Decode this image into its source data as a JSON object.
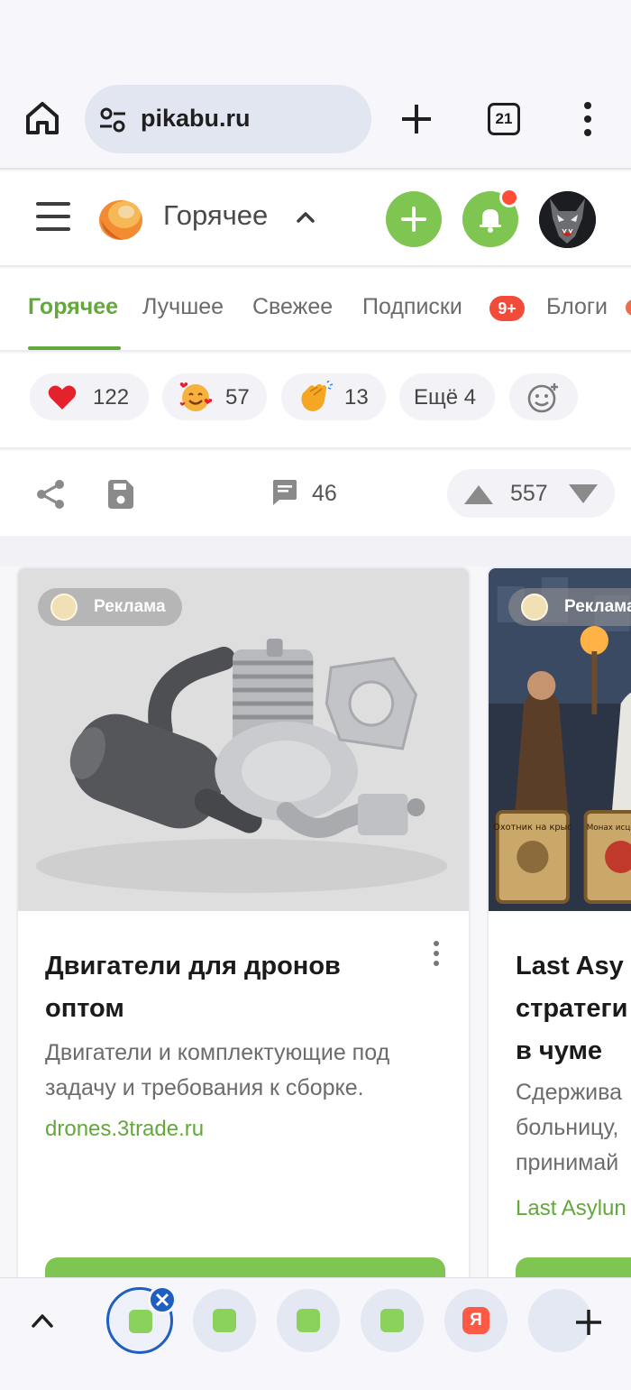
{
  "browser": {
    "url": "pikabu.ru",
    "tab_count": "21"
  },
  "header": {
    "feed_title": "Горячее",
    "icons": [
      "menu-icon",
      "logo-icon",
      "chevron-up-icon",
      "plus-icon",
      "bell-icon",
      "avatar"
    ],
    "accent": "#7ec552",
    "notification_dot_color": "#ff4d38"
  },
  "tabs": [
    {
      "label": "Горячее",
      "active": true
    },
    {
      "label": "Лучшее",
      "active": false
    },
    {
      "label": "Свежее",
      "active": false
    },
    {
      "label": "Подписки",
      "active": false,
      "badge": "9+"
    },
    {
      "label": "Блоги",
      "active": false
    }
  ],
  "reactions": [
    {
      "icon": "heart-icon",
      "count": "122"
    },
    {
      "icon": "hearts-face-icon",
      "count": "57"
    },
    {
      "icon": "clap-icon",
      "count": "13"
    },
    {
      "label": "Ещё 4"
    },
    {
      "icon": "add-reaction-icon"
    }
  ],
  "post_actions": {
    "comments": "46",
    "score": "557"
  },
  "ads": [
    {
      "label": "Реклама",
      "title": "Двигатели для дронов оптом",
      "description": "Двигатели и комплектующие под задачу и требования к сборке.",
      "domain": "drones.3trade.ru"
    },
    {
      "label": "Реклама",
      "title_lines": [
        "Last Asy",
        "стратеги",
        "в чуме"
      ],
      "description_lines": [
        "Сдержива",
        "больницу,",
        "принимай"
      ],
      "domain": "Last Asylun",
      "card_caption_1": "Охотник на крыс",
      "card_caption_2": "Монах исцелите"
    }
  ],
  "tab_strip": {
    "tabs": [
      "pikabu",
      "pikabu",
      "pikabu",
      "pikabu",
      "yandex"
    ],
    "yandex_letter": "Я"
  }
}
